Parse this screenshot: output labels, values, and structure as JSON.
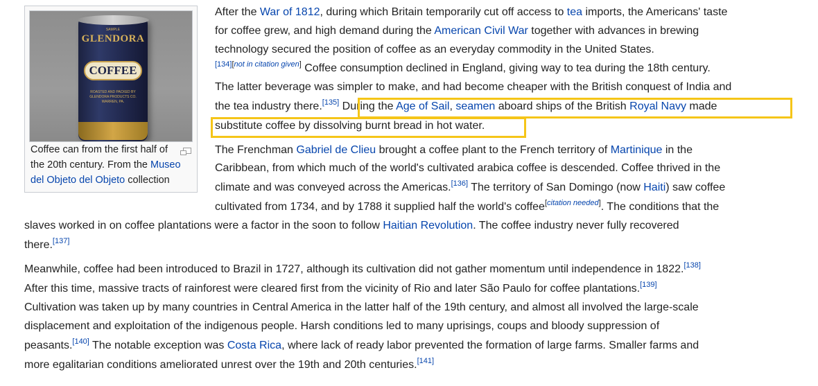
{
  "figure": {
    "caption_parts": [
      "Coffee can from the first half of the 20th century. From the ",
      "Museo del Objeto del Objeto",
      " collection"
    ],
    "magnify_icon": "magnify-clip-icon",
    "can": {
      "top_text": "SAMPLE",
      "brand": "GLENDORA",
      "label": "COFFEE",
      "bottom_text": "ROASTED AND PACKED BY GLENDORA PRODUCTS CO. WARREN, PA."
    }
  },
  "paragraph1": {
    "l1": {
      "t1": "After the ",
      "a1": "War of 1812",
      "t2": ", during which Britain temporarily cut off access to ",
      "a2": "tea",
      "t3": " imports, the Americans' taste"
    },
    "l2": {
      "t1": "for coffee grew, and high demand during the ",
      "a1": "American Civil War",
      "t2": " together with advances in brewing"
    },
    "l3": {
      "t1": "technology secured the position of coffee as an everyday commodity in the United States."
    },
    "l4": {
      "c1": "[134]",
      "c2": "[",
      "c3": "not in citation given",
      "c4": "]",
      "t1": " Coffee consumption declined in England, giving way to tea during the 18th century."
    },
    "l5": {
      "t1": "The latter beverage was simpler to make, and had become cheaper with the British conquest of India and"
    },
    "l6": {
      "t1": "the tea industry there.",
      "c1": "[135]",
      "t2": " During the ",
      "a1": "Age of Sail",
      "t3": ", ",
      "a2": "seamen",
      "t4": " aboard ships of the British ",
      "a3": "Royal Navy",
      "t5": " made"
    },
    "l7": {
      "t1": "substitute coffee by dissolving burnt bread in hot water."
    }
  },
  "paragraph2": {
    "l1": {
      "t1": "The Frenchman ",
      "a1": "Gabriel de Clieu",
      "t2": " brought a coffee plant to the French territory of ",
      "a2": "Martinique",
      "t3": " in the"
    },
    "l2": {
      "t1": "Caribbean, from which much of the world's cultivated arabica coffee is descended. Coffee thrived in the"
    },
    "l3": {
      "t1": "climate and was conveyed across the Americas.",
      "c1": "[136]",
      "t2": " The territory of San Domingo (now ",
      "a1": "Haiti",
      "t3": ") saw coffee"
    },
    "l4": {
      "t1": "cultivated from 1734, and by 1788 it supplied half the world's coffee",
      "c1": "[",
      "c2": "citation needed",
      "c3": "]",
      "t2": ". The conditions that the"
    },
    "l5": {
      "t1": "slaves worked in on coffee plantations were a factor in the soon to follow ",
      "a1": "Haitian Revolution",
      "t2": ". The coffee industry never fully recovered"
    },
    "l6": {
      "t1": "there.",
      "c1": "[137]"
    }
  },
  "paragraph3": {
    "l1": {
      "t1": "Meanwhile, coffee had been introduced to Brazil in 1727, although its cultivation did not gather momentum until independence in 1822.",
      "c1": "[138]"
    },
    "l2": {
      "t1": "After this time, massive tracts of rainforest were cleared first from the vicinity of Rio and later São Paulo for coffee plantations.",
      "c1": "[139]"
    },
    "l3": {
      "t1": "Cultivation was taken up by many countries in Central America in the latter half of the 19th century, and almost all involved the large-scale"
    },
    "l4": {
      "t1": "displacement and exploitation of the indigenous people. Harsh conditions led to many uprisings, coups and bloody suppression of"
    },
    "l5": {
      "t1": "peasants.",
      "c1": "[140]",
      "t2": " The notable exception was ",
      "a1": "Costa Rica",
      "t3": ", where lack of ready labor prevented the formation of large farms. Smaller farms and"
    },
    "l6": {
      "t1": "more egalitarian conditions ameliorated unrest over the 19th and 20th centuries.",
      "c1": "[141]"
    }
  },
  "colors": {
    "link": "#0645ad",
    "text": "#222222",
    "highlight": "#f5c518",
    "thumb_border": "#c8ccd1",
    "thumb_bg": "#f9f9f9"
  }
}
